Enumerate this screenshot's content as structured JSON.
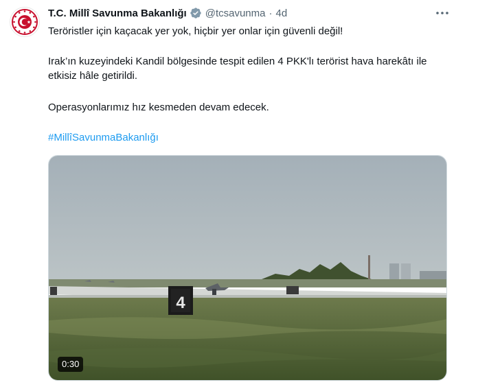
{
  "tweet": {
    "author_name": "T.C. Millî Savunma Bakanlığı",
    "handle": "@tcsavunma",
    "separator": "·",
    "time": "4d",
    "paragraphs": [
      "Teröristler için kaçacak yer yok, hiçbir yer onlar için güvenli değil!",
      "Irak’ın kuzeyindeki Kandil bölgesinde tespit edilen 4 PKK'lı terörist hava harekâtı ile etkisiz hâle getirildi.",
      "Operasyonlarımız hız kesmeden devam edecek."
    ],
    "hashtag": "#MillîSavunmaBakanlığı",
    "media": {
      "duration": "0:30",
      "sign_number": "4"
    }
  },
  "icons": {
    "avatar": "ministry-emblem-icon",
    "verified": "verified-badge-icon",
    "more": "more-options-icon"
  },
  "colors": {
    "link": "#1d9bf0",
    "secondary_text": "#536471",
    "verified_badge": "#829aab",
    "emblem_red": "#c8102e"
  }
}
